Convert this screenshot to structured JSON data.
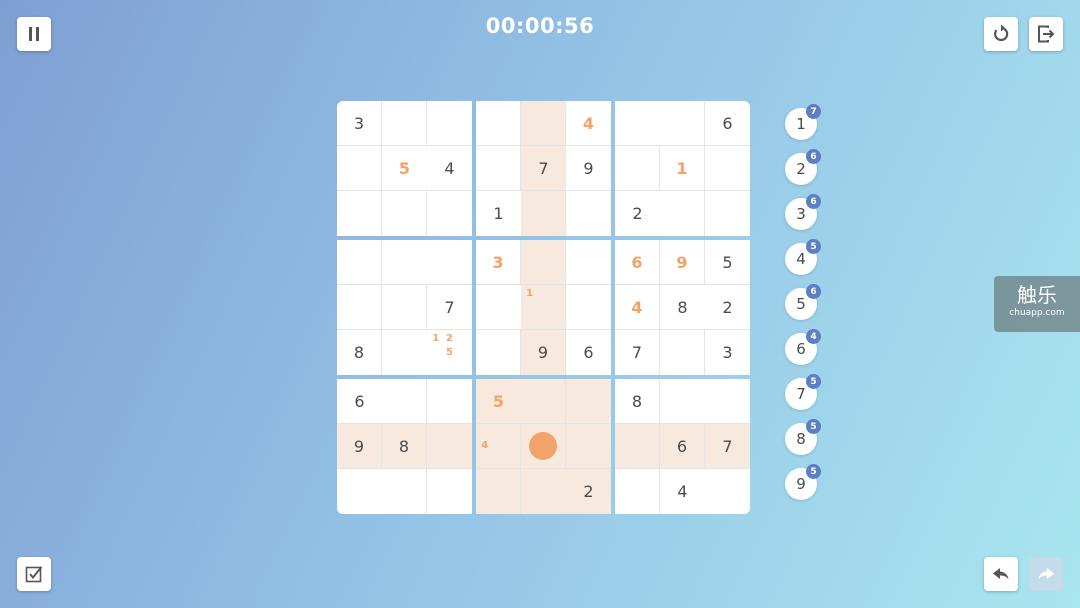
{
  "timer": "00:00:56",
  "icons": {
    "pause": "pause-icon",
    "restart": "restart-icon",
    "exit": "exit-icon",
    "check": "check-icon",
    "undo": "undo-icon",
    "redo": "redo-icon"
  },
  "colors": {
    "user_digit": "#f2a36a",
    "highlight": "#f8e9de",
    "badge": "#5c7ec2",
    "given_digit": "#4b4b4b"
  },
  "board": {
    "selected": {
      "row": 7,
      "col": 4
    },
    "rows": [
      [
        {
          "v": "3"
        },
        {
          "v": ""
        },
        {
          "v": ""
        },
        {
          "v": ""
        },
        {
          "v": ""
        },
        {
          "v": "4",
          "user": true
        },
        {
          "v": ""
        },
        {
          "v": ""
        },
        {
          "v": "6"
        }
      ],
      [
        {
          "v": ""
        },
        {
          "v": "5",
          "user": true
        },
        {
          "v": "4"
        },
        {
          "v": ""
        },
        {
          "v": "7"
        },
        {
          "v": "9"
        },
        {
          "v": ""
        },
        {
          "v": "1",
          "user": true
        },
        {
          "v": ""
        }
      ],
      [
        {
          "v": ""
        },
        {
          "v": ""
        },
        {
          "v": ""
        },
        {
          "v": "1"
        },
        {
          "v": ""
        },
        {
          "v": ""
        },
        {
          "v": "2"
        },
        {
          "v": ""
        },
        {
          "v": ""
        }
      ],
      [
        {
          "v": ""
        },
        {
          "v": ""
        },
        {
          "v": ""
        },
        {
          "v": "3",
          "user": true
        },
        {
          "v": ""
        },
        {
          "v": ""
        },
        {
          "v": "6",
          "user": true
        },
        {
          "v": "9",
          "user": true
        },
        {
          "v": "5"
        }
      ],
      [
        {
          "v": ""
        },
        {
          "v": ""
        },
        {
          "v": "7"
        },
        {
          "v": ""
        },
        {
          "v": "",
          "notes": [
            "1",
            "",
            "",
            "",
            "",
            "",
            "",
            "",
            ""
          ]
        },
        {
          "v": ""
        },
        {
          "v": "4",
          "user": true
        },
        {
          "v": "8"
        },
        {
          "v": "2"
        }
      ],
      [
        {
          "v": "8"
        },
        {
          "v": ""
        },
        {
          "v": "",
          "notes": [
            "1",
            "2",
            "",
            "",
            "5",
            "",
            "",
            "",
            ""
          ]
        },
        {
          "v": ""
        },
        {
          "v": "9"
        },
        {
          "v": "6"
        },
        {
          "v": "7"
        },
        {
          "v": ""
        },
        {
          "v": "3"
        }
      ],
      [
        {
          "v": "6"
        },
        {
          "v": ""
        },
        {
          "v": ""
        },
        {
          "v": "5",
          "user": true
        },
        {
          "v": ""
        },
        {
          "v": ""
        },
        {
          "v": "8"
        },
        {
          "v": ""
        },
        {
          "v": ""
        }
      ],
      [
        {
          "v": "9"
        },
        {
          "v": "8"
        },
        {
          "v": ""
        },
        {
          "v": "",
          "notes": [
            "",
            "",
            "",
            "4",
            "",
            "",
            "",
            "",
            ""
          ]
        },
        {
          "v": ""
        },
        {
          "v": ""
        },
        {
          "v": ""
        },
        {
          "v": "6"
        },
        {
          "v": "7"
        }
      ],
      [
        {
          "v": ""
        },
        {
          "v": ""
        },
        {
          "v": ""
        },
        {
          "v": ""
        },
        {
          "v": ""
        },
        {
          "v": "2"
        },
        {
          "v": ""
        },
        {
          "v": "4"
        },
        {
          "v": ""
        }
      ]
    ]
  },
  "numpad": [
    {
      "digit": "1",
      "remaining": "7"
    },
    {
      "digit": "2",
      "remaining": "6"
    },
    {
      "digit": "3",
      "remaining": "6"
    },
    {
      "digit": "4",
      "remaining": "5"
    },
    {
      "digit": "5",
      "remaining": "6"
    },
    {
      "digit": "6",
      "remaining": "4"
    },
    {
      "digit": "7",
      "remaining": "5"
    },
    {
      "digit": "8",
      "remaining": "5"
    },
    {
      "digit": "9",
      "remaining": "5"
    }
  ],
  "watermark": {
    "main": "触乐",
    "sub": "chuapp.com"
  }
}
